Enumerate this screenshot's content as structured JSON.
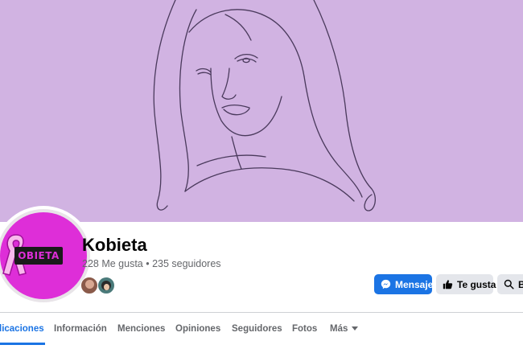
{
  "page": {
    "name": "Kobieta",
    "stats": "228 Me gusta • 235 seguidores",
    "logo_text": "OBIETA"
  },
  "actions": {
    "message_label": "Mensaje",
    "like_label": "Te gusta",
    "search_label": "Bu"
  },
  "tabs": [
    {
      "label": "licaciones",
      "active": true
    },
    {
      "label": "Información"
    },
    {
      "label": "Menciones"
    },
    {
      "label": "Opiniones"
    },
    {
      "label": "Seguidores"
    },
    {
      "label": "Fotos"
    },
    {
      "label": "Más"
    }
  ],
  "colors": {
    "cover_background": "#d1b3e2",
    "brand_pink": "#de2ed8",
    "primary_blue": "#1b74e4",
    "secondary_button": "#e4e6eb"
  },
  "icons": {
    "message": "messenger-icon",
    "like": "thumbs-up-icon",
    "search": "search-icon",
    "more": "caret-down-icon"
  }
}
